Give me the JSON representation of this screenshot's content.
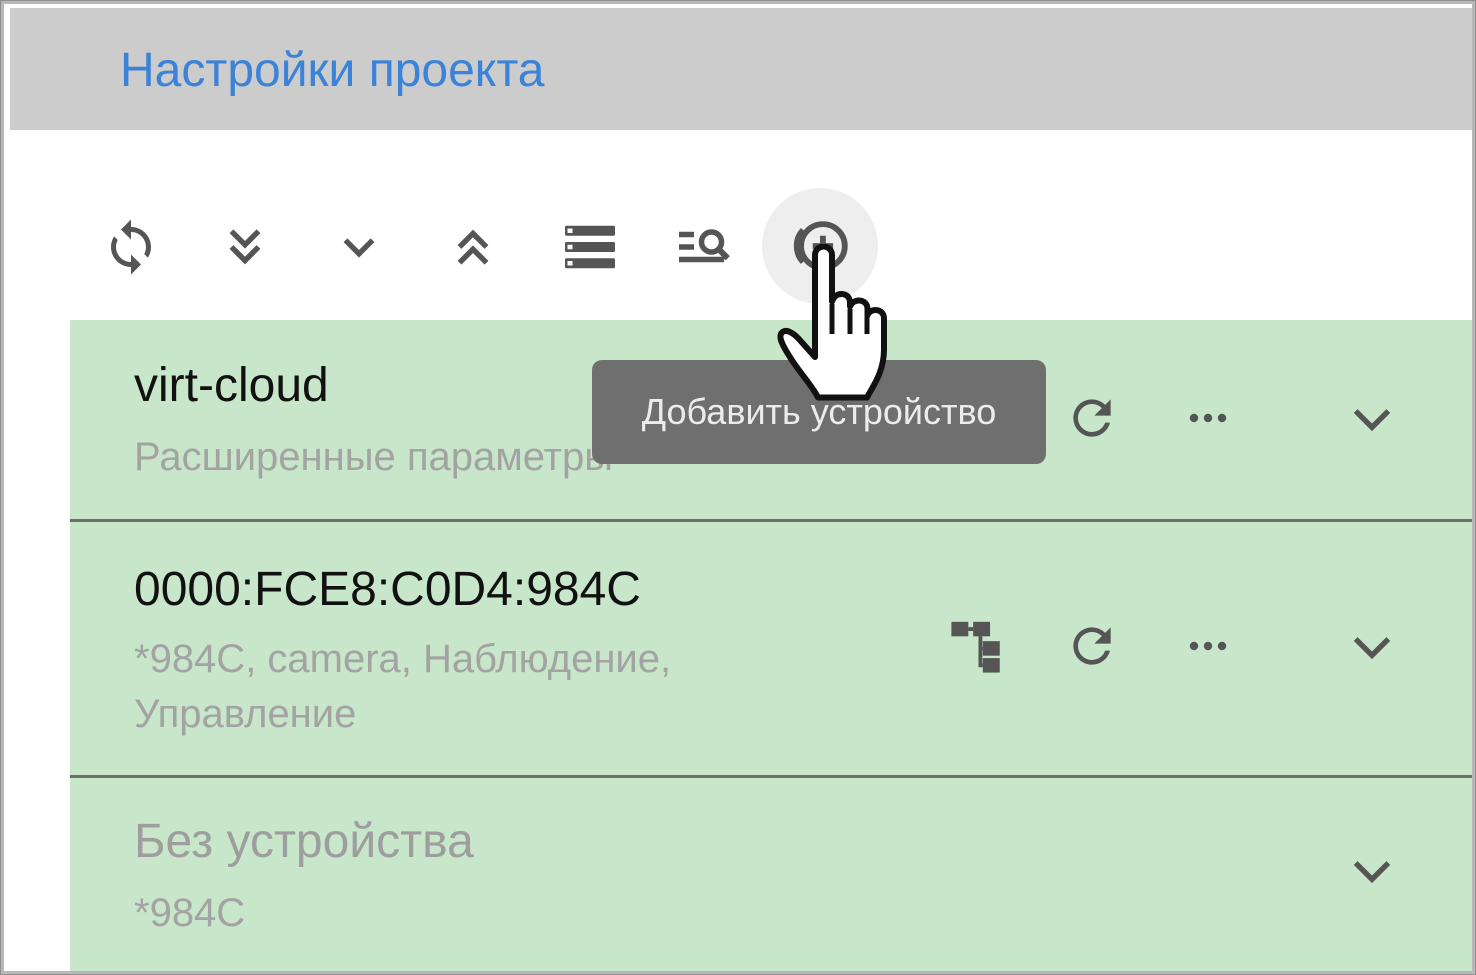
{
  "header": {
    "title": "Настройки проекта"
  },
  "toolbar": {
    "buttons": [
      {
        "name": "refresh-button",
        "icon": "sync-icon"
      },
      {
        "name": "expand-all-button",
        "icon": "double-chevron-down-icon"
      },
      {
        "name": "expand-button",
        "icon": "chevron-down-icon"
      },
      {
        "name": "collapse-all-button",
        "icon": "double-chevron-up-icon"
      },
      {
        "name": "list-view-button",
        "icon": "list-icon"
      },
      {
        "name": "search-list-button",
        "icon": "list-search-icon"
      },
      {
        "name": "add-device-button",
        "icon": "add-circle-icon"
      }
    ],
    "tooltip": "Добавить устройство"
  },
  "rows": [
    {
      "title": "virt-cloud",
      "subtitle": "Расширенные параметры"
    },
    {
      "title": "0000:FCE8:C0D4:984C",
      "subtitle": "*984C, camera, Наблюдение, Управление"
    },
    {
      "title": "Без устройства",
      "subtitle": "*984C"
    }
  ],
  "colors": {
    "header_bg": "#cccccc",
    "header_title": "#3b82d9",
    "row_bg": "#c8e6c9",
    "tooltip_bg": "#6f6f6f"
  }
}
